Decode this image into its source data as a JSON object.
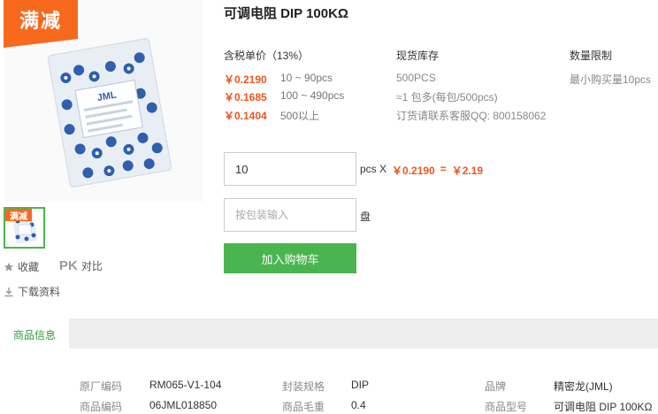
{
  "promo": {
    "label": "满减",
    "thumb_label": "满减"
  },
  "product": {
    "title": "可调电阻 DIP 100KΩ",
    "bag_brand": "JML"
  },
  "sidebar": {
    "favorite_label": "收藏",
    "pk_badge": "PK",
    "compare_label": "对比",
    "download_label": "下载资料"
  },
  "pricing": {
    "header": "含税单价（13%）",
    "tiers": [
      {
        "price": "￥0.2190",
        "qty": "10 ~ 90pcs"
      },
      {
        "price": "￥0.1685",
        "qty": "100 ~ 490pcs"
      },
      {
        "price": "￥0.1404",
        "qty": "500以上"
      }
    ]
  },
  "stock": {
    "header": "现货库存",
    "amount": "500PCS",
    "pack": "≈1 包多(每包/500pcs)",
    "contact": "订货请联系客服QQ: 800158062"
  },
  "limit": {
    "header": "数量限制",
    "min": "最小购买量10pcs"
  },
  "order": {
    "quantity_value": "10",
    "unit": "pcs X",
    "unit_price": "￥0.2190",
    "equals": "=",
    "total": "￥2.19",
    "pack_placeholder": "按包装输入",
    "pack_unit": "盘",
    "add_to_cart": "加入购物车"
  },
  "tabs": {
    "active": "商品信息"
  },
  "specs": [
    {
      "k1": "原厂编码",
      "v1": "RM065-V1-104",
      "k2": "封装规格",
      "v2": "DIP",
      "k3": "品牌",
      "v3": "精密龙(JML)"
    },
    {
      "k1": "商品编码",
      "v1": "06JML018850",
      "k2": "商品毛重",
      "v2": "0.4",
      "k3": "商品型号",
      "v3": "可调电阻 DIP 100KΩ"
    }
  ],
  "colors": {
    "accent_green": "#4ab54e",
    "promo_orange": "#f76a1e",
    "price_orange": "#f0541e"
  }
}
